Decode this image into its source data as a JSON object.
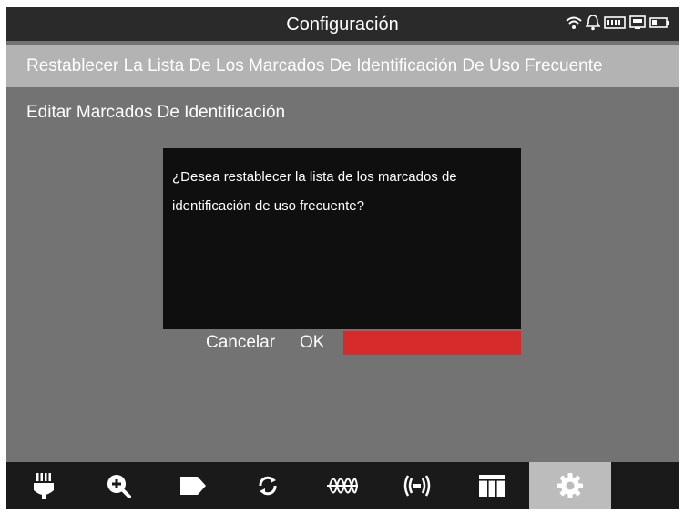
{
  "header": {
    "title": "Configuración",
    "status_icons": [
      "wifi-icon",
      "bell-icon",
      "memory-card-icon",
      "monitor-icon",
      "battery-icon"
    ]
  },
  "menu": {
    "items": [
      {
        "label": "Restablecer La Lista De Los Marcados De Identificación De Uso Frecuente",
        "selected": true
      },
      {
        "label": "Editar Marcados De Identificación",
        "selected": false
      }
    ]
  },
  "dialog": {
    "message_line1": "¿Desea restablecer la lista de los marcados de",
    "message_line2": "identificación de uso frecuente?",
    "cancel_label": "Cancelar",
    "ok_label": "OK"
  },
  "navbar": {
    "items": [
      {
        "icon": "connector-icon"
      },
      {
        "icon": "zoom-in-icon"
      },
      {
        "icon": "tag-icon"
      },
      {
        "icon": "refresh-icon"
      },
      {
        "icon": "waveform-icon"
      },
      {
        "icon": "signal-icon"
      },
      {
        "icon": "grid-icon"
      },
      {
        "icon": "gear-icon",
        "active": true
      }
    ]
  },
  "colors": {
    "background": "#737373",
    "topbar": "#2a2a2a",
    "selected_row": "#b3b3b3",
    "dialog": "#0f0f0f",
    "ok_accent": "#d52b2b",
    "navbar": "#1a1a1a",
    "navbar_active": "#bcbcbc"
  }
}
